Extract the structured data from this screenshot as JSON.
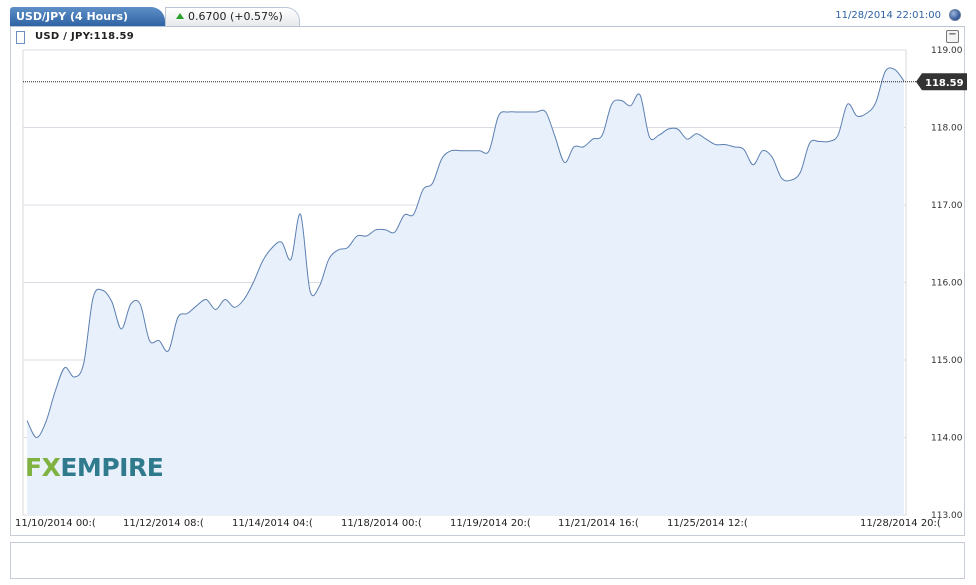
{
  "header": {
    "title": "USD/JPY (4 Hours)",
    "change": "0.6700 (+0.57%)",
    "datetime": "11/28/2014 22:01:00"
  },
  "legend": {
    "label": "USD / JPY:118.59"
  },
  "minimize_label": "−",
  "logo": {
    "part1": "FX",
    "part2": "EMPIRE"
  },
  "colors": {
    "line": "#5b7fb0",
    "fill": "#e8f0fc",
    "accent": "#2f63a3",
    "up": "#2aa12a",
    "navigator_fill": "#6c8fd6"
  },
  "chart_data": {
    "type": "area",
    "title": "USD/JPY (4 Hours)",
    "xlabel": "",
    "ylabel": "",
    "ylim": [
      113.0,
      119.0
    ],
    "yticks": [
      "119.00",
      "118.00",
      "117.00",
      "116.00",
      "115.00",
      "114.00",
      "113.00"
    ],
    "xtick_labels": [
      "11/10/2014 00:(",
      "11/12/2014 08:(",
      "11/14/2014 04:(",
      "11/18/2014 00:(",
      "11/19/2014 20:(",
      "11/21/2014 16:(",
      "11/25/2014 12:(",
      "11/28/2014 20:("
    ],
    "last_value_label": "118.59",
    "last_value": 118.59,
    "grid": true,
    "values": [
      114.22,
      114.0,
      114.2,
      114.6,
      114.9,
      114.78,
      114.95,
      115.8,
      115.9,
      115.75,
      115.4,
      115.72,
      115.72,
      115.25,
      115.25,
      115.12,
      115.55,
      115.6,
      115.7,
      115.78,
      115.65,
      115.78,
      115.68,
      115.78,
      116.0,
      116.28,
      116.45,
      116.52,
      116.3,
      116.88,
      115.9,
      115.95,
      116.3,
      116.42,
      116.45,
      116.6,
      116.6,
      116.68,
      116.68,
      116.65,
      116.87,
      116.88,
      117.2,
      117.28,
      117.6,
      117.7,
      117.7,
      117.7,
      117.7,
      117.7,
      118.15,
      118.2,
      118.2,
      118.2,
      118.2,
      118.2,
      117.88,
      117.55,
      117.75,
      117.75,
      117.85,
      117.9,
      118.3,
      118.35,
      118.28,
      118.42,
      117.88,
      117.9,
      117.98,
      117.98,
      117.85,
      117.92,
      117.85,
      117.78,
      117.78,
      117.75,
      117.72,
      117.52,
      117.7,
      117.62,
      117.35,
      117.32,
      117.42,
      117.8,
      117.82,
      117.82,
      117.9,
      118.3,
      118.15,
      118.18,
      118.32,
      118.72,
      118.75,
      118.6
    ]
  }
}
